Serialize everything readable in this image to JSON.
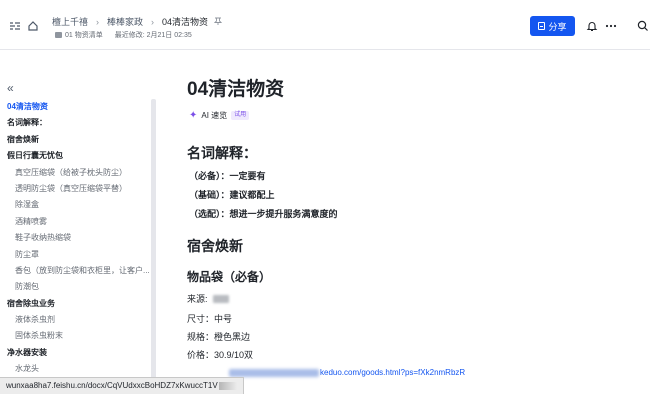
{
  "header": {
    "breadcrumbs": [
      "檀上千禧",
      "棒棒家政",
      "04清洁物资"
    ],
    "folder_label": "01 物资清单",
    "last_modified": "最近修改: 2月21日 02:35",
    "share_label": "分享"
  },
  "sidebar": {
    "items": [
      {
        "label": "04清洁物资",
        "level": 1,
        "active": true
      },
      {
        "label": "名词解释：",
        "level": 1
      },
      {
        "label": "宿舍焕新",
        "level": 1,
        "collapsed": true
      },
      {
        "label": "假日行囊无忧包",
        "level": 1
      },
      {
        "label": "真空压缩袋（给被子枕头防尘）",
        "level": 2
      },
      {
        "label": "透明防尘袋（真空压缩袋平替）",
        "level": 2
      },
      {
        "label": "除湿盒",
        "level": 2
      },
      {
        "label": "酒精喷雾",
        "level": 2
      },
      {
        "label": "鞋子收纳热缩袋",
        "level": 2
      },
      {
        "label": "防尘罩",
        "level": 2
      },
      {
        "label": "香包（放到防尘袋和衣柜里，让客户...",
        "level": 2
      },
      {
        "label": "防潮包",
        "level": 2
      },
      {
        "label": "宿舍除虫业务",
        "level": 1
      },
      {
        "label": "液体杀虫剂",
        "level": 2
      },
      {
        "label": "固体杀虫粉末",
        "level": 2
      },
      {
        "label": "净水器安装",
        "level": 1
      },
      {
        "label": "水龙头",
        "level": 2
      }
    ]
  },
  "doc": {
    "title": "04清洁物资",
    "ai_label": "AI 速览",
    "ai_badge": "试用",
    "section1": "名词解释：",
    "terms": [
      "（必备）：一定要有",
      "（基础）：建议都配上",
      "（选配）：想进一步提升服务满意度的"
    ],
    "section2": "宿舍焕新",
    "subsection": "物品袋（必备）",
    "source_label": "来源:",
    "size_line": "尺寸：中号",
    "spec_line": "规格：橙色黑边",
    "price_line": "价格：30.9/10双",
    "link_text": "keduo.com/goods.html?ps=fXk2nmRbzR"
  },
  "status_url": "wunxaa8ha7.feishu.cn/docx/CqVUdxxcBoHDZ7xKwuccT1V",
  "colors": {
    "accent": "#1456f0",
    "ai_purple": "#7b4fe8"
  },
  "icons": [
    "sidebar-toggle-icon",
    "home-icon",
    "folder-icon",
    "document-icon",
    "bell-icon",
    "more-icon",
    "search-icon",
    "sparkle-icon",
    "collapse-icon",
    "pin-icon",
    "caret-right-icon"
  ]
}
